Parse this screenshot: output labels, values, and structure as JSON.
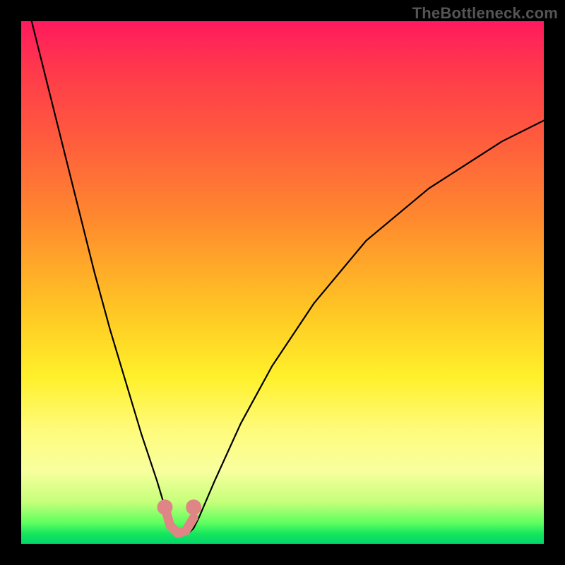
{
  "watermark": "TheBottleneck.com",
  "accent_colors": {
    "highlight_stroke": "#e08585",
    "curve_stroke": "#000000"
  },
  "chart_data": {
    "type": "line",
    "title": "",
    "xlabel": "",
    "ylabel": "",
    "xlim": [
      0,
      100
    ],
    "ylim": [
      0,
      100
    ],
    "grid": false,
    "legend": false,
    "series": [
      {
        "name": "bottleneck-curve",
        "x": [
          2,
          5,
          8,
          11,
          14,
          17,
          20,
          23,
          26,
          27.5,
          29,
          30.5,
          32,
          33,
          34,
          37,
          42,
          48,
          56,
          66,
          78,
          92,
          100
        ],
        "y": [
          100,
          88,
          76,
          64,
          52,
          41,
          31,
          21,
          12,
          7,
          3.5,
          2,
          2,
          3,
          5,
          12,
          23,
          34,
          46,
          58,
          68,
          77,
          81
        ]
      }
    ],
    "highlights": [
      {
        "name": "left-marker",
        "x": 27.5,
        "y": 7
      },
      {
        "name": "right-marker",
        "x": 33.0,
        "y": 7
      }
    ],
    "highlight_segment": {
      "x": [
        27.5,
        28.5,
        30.0,
        31.5,
        33.0
      ],
      "y": [
        7,
        3.5,
        2,
        2.5,
        5
      ]
    }
  }
}
